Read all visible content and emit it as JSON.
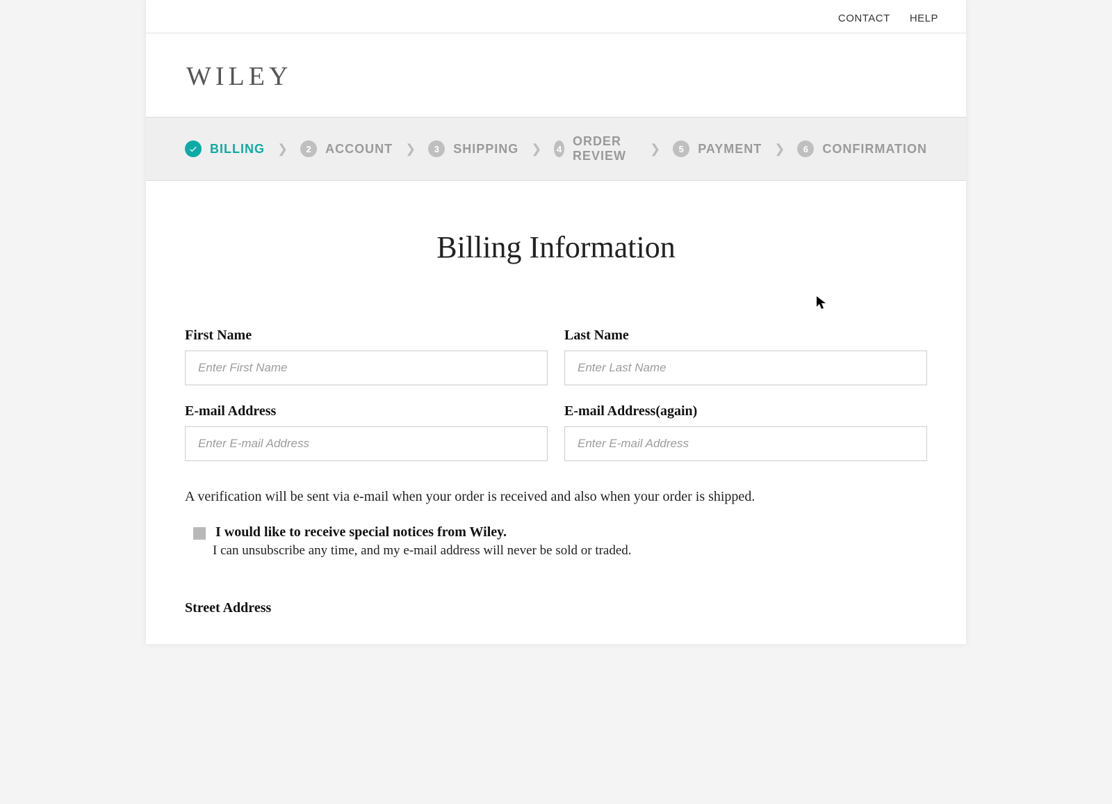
{
  "topbar": {
    "contact": "CONTACT",
    "help": "HELP"
  },
  "brand": {
    "name": "WILEY"
  },
  "progress": {
    "steps": [
      {
        "label": "BILLING",
        "num": "1",
        "active": true
      },
      {
        "label": "ACCOUNT",
        "num": "2",
        "active": false
      },
      {
        "label": "SHIPPING",
        "num": "3",
        "active": false
      },
      {
        "label": "ORDER REVIEW",
        "num": "4",
        "active": false
      },
      {
        "label": "PAYMENT",
        "num": "5",
        "active": false
      },
      {
        "label": "CONFIRMATION",
        "num": "6",
        "active": false
      }
    ]
  },
  "page": {
    "title": "Billing Information"
  },
  "form": {
    "first_name": {
      "label": "First Name",
      "placeholder": "Enter First Name",
      "value": ""
    },
    "last_name": {
      "label": "Last Name",
      "placeholder": "Enter Last Name",
      "value": ""
    },
    "email": {
      "label": "E-mail Address",
      "placeholder": "Enter E-mail Address",
      "value": ""
    },
    "email_again": {
      "label": "E-mail Address(again)",
      "placeholder": "Enter E-mail Address",
      "value": ""
    },
    "street": {
      "label": "Street Address"
    }
  },
  "notes": {
    "verification": "A verification will be sent via e-mail when your order is received and also when your order is shipped."
  },
  "optin": {
    "checked": false,
    "headline": "I would like to receive special notices from Wiley.",
    "sub": "I can unsubscribe any time, and my e-mail address will never be sold or traded."
  }
}
